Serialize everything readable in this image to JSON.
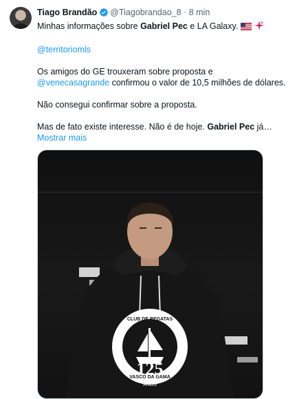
{
  "tweet": {
    "author_name": "Tiago Brandão",
    "handle": "@Tiagobrandao_8",
    "separator": "·",
    "time": "8 min",
    "line1_a": "Minhas informações sobre ",
    "line1_b": "Gabriel Pec",
    "line1_c": " e LA Galaxy.",
    "mention_1": "@territoriomls",
    "line3_a": "Os amigos do GE trouxeram sobre proposta e ",
    "mention_2": "@venecasagrande",
    "line3_b": " confirmou o valor de 10,5 milhões de dólares.",
    "line4": "Não consegui confirmar sobre a proposta.",
    "line5_a": "Mas de fato existe interesse. Não é de hoje. ",
    "line5_b": "Gabriel Pec",
    "line5_c": " já…",
    "show_more": "Mostrar mais",
    "badge_lines": [
      "CLUB DE REGATAS",
      "VASCO DA GAMA"
    ],
    "badge_number": "125",
    "badge_word": "ANOS"
  },
  "colors": {
    "link": "#1d9bf0",
    "verified": "#1d9bf0",
    "text": "#0f1419",
    "muted": "#536471"
  },
  "icons": [
    "avatar",
    "verified-badge-icon",
    "us-flag-emoji",
    "sparkle-emoji",
    "vasco-crest"
  ]
}
